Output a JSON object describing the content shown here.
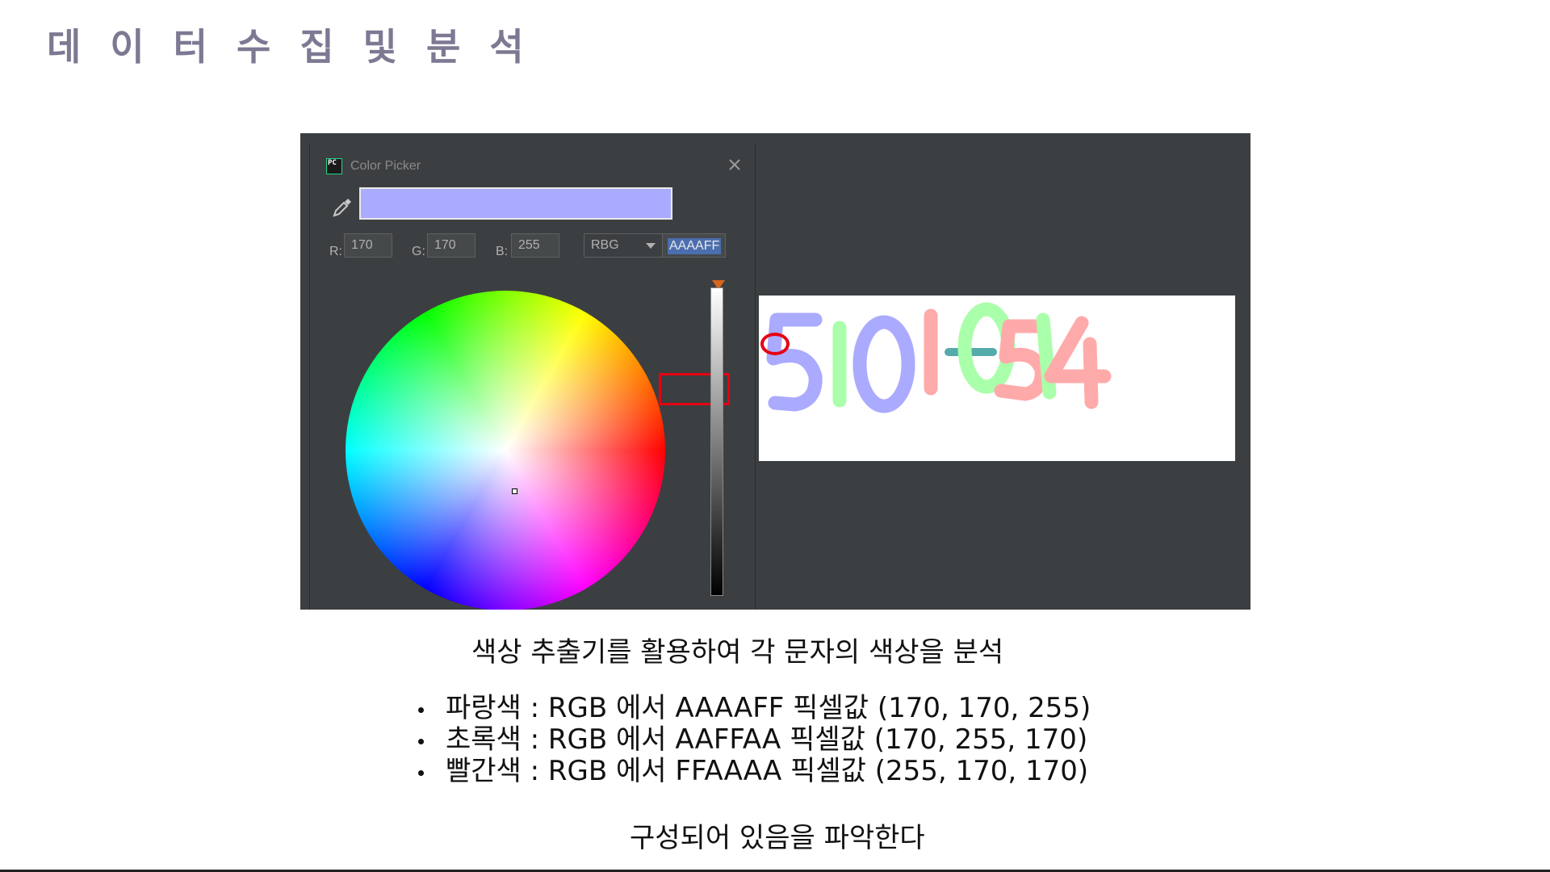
{
  "slide": {
    "title": "데 이 터 수 집 및 분 석",
    "caption": "색상 추출기를 활용하여 각 문자의 색상을 분석",
    "bullets": [
      "파랑색 : RGB 에서 AAAAFF 픽셀값 (170, 170, 255)",
      "초록색 : RGB 에서 AAFFAA 픽셀값 (170, 255, 170)",
      "빨간색 : RGB 에서 FFAAAA 픽셀값 (255, 170, 170)"
    ],
    "conclusion": "구성되어 있음을 파악한다",
    "title_color": "#7e7893"
  },
  "color_picker": {
    "window_title": "Color Picker",
    "app_icon_text": "PC",
    "preview_color": "#aaaaff",
    "r_label": "R:",
    "g_label": "G:",
    "b_label": "B:",
    "r_value": "170",
    "g_value": "170",
    "b_value": "255",
    "mode_value": "RBG",
    "hex_value": "AAAAFF",
    "icons": [
      "pc-app-icon",
      "close-icon",
      "pipette-icon",
      "chevron-down-icon"
    ]
  },
  "captcha": {
    "text": "5101-0514",
    "colors": {
      "blue": "#aaaaff",
      "green": "#aaffaa",
      "red": "#ffaaaa",
      "overlap": "#55aaaa"
    }
  },
  "highlight_color": "#e60012"
}
